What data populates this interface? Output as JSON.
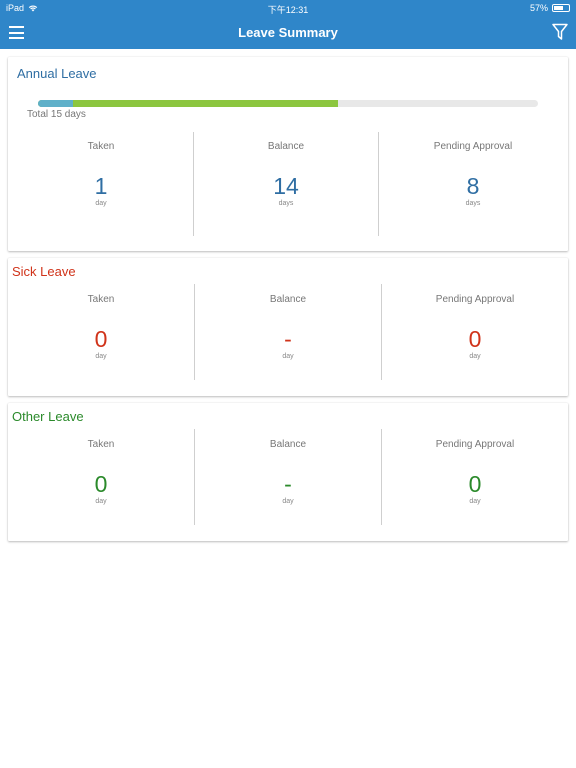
{
  "status_bar": {
    "device": "iPad",
    "time": "下午12:31",
    "battery": "57%"
  },
  "header": {
    "title": "Leave Summary"
  },
  "colors": {
    "header": "#2f86c9",
    "annual": "#2f6ea3",
    "sick": "#d0331a",
    "other": "#2b8a2b"
  },
  "annual": {
    "title": "Annual Leave",
    "total_label": "Total 15 days",
    "progress": {
      "total": 15,
      "taken": 1,
      "balance": 14,
      "pending": 8
    },
    "taken": {
      "label": "Taken",
      "value": "1",
      "unit": "day"
    },
    "balance": {
      "label": "Balance",
      "value": "14",
      "unit": "days"
    },
    "pending": {
      "label": "Pending Approval",
      "value": "8",
      "unit": "days"
    }
  },
  "sick": {
    "title": "Sick Leave",
    "taken": {
      "label": "Taken",
      "value": "0",
      "unit": "day"
    },
    "balance": {
      "label": "Balance",
      "value": "-",
      "unit": "day"
    },
    "pending": {
      "label": "Pending Approval",
      "value": "0",
      "unit": "day"
    }
  },
  "other": {
    "title": "Other Leave",
    "taken": {
      "label": "Taken",
      "value": "0",
      "unit": "day"
    },
    "balance": {
      "label": "Balance",
      "value": "-",
      "unit": "day"
    },
    "pending": {
      "label": "Pending Approval",
      "value": "0",
      "unit": "day"
    }
  }
}
